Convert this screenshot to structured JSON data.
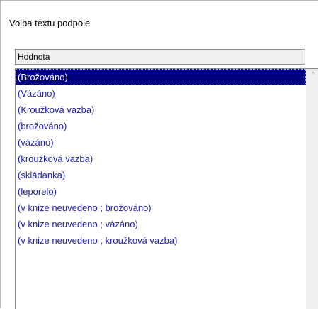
{
  "dialog": {
    "title": "Volba textu podpole"
  },
  "list": {
    "column_header": "Hodnota",
    "selected_index": 0,
    "items": [
      "(Brožováno)",
      "(Vázáno)",
      "(Kroužková vazba)",
      "(brožováno)",
      "(vázáno)",
      "(kroužková vazba)",
      "(skládanka)",
      "(leporelo)",
      "(v knize neuvedeno ; brožováno)",
      "(v knize neuvedeno ; vázáno)",
      "(v knize neuvedeno ; kroužková vazba)"
    ]
  },
  "scrollbar": {
    "up_icon": "chevron-up-icon",
    "up_glyph": "^"
  },
  "colors": {
    "selection_bg": "#000080",
    "item_text": "#1f1fb0"
  }
}
